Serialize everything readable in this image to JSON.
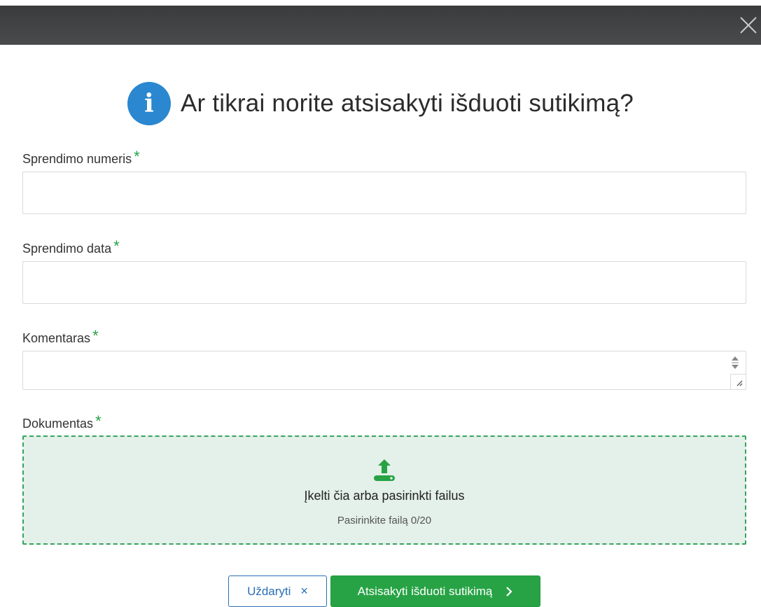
{
  "dialog": {
    "title": "Ar tikrai norite atsisakyti išduoti sutikimą?",
    "info_icon": "info-icon",
    "close_icon": "close-icon"
  },
  "form": {
    "fields": [
      {
        "label": "Sprendimo numeris",
        "required_mark": "*",
        "value": ""
      },
      {
        "label": "Sprendimo data",
        "required_mark": "*",
        "value": ""
      },
      {
        "label": "Komentaras",
        "required_mark": "*",
        "value": ""
      },
      {
        "label": "Dokumentas",
        "required_mark": "*"
      }
    ],
    "dropzone": {
      "icon": "upload-icon",
      "main_text": "Įkelti čia arba pasirinkti failus",
      "sub_text": "Pasirinkite failą 0/20"
    }
  },
  "buttons": {
    "close_label": "Uždaryti",
    "close_icon": "×",
    "confirm_label": "Atsisakyti išduoti sutikimą",
    "confirm_icon": "chevron-right-icon"
  },
  "colors": {
    "accent_green": "#27a345",
    "info_blue": "#2a87d0",
    "link_blue": "#2a6fb5",
    "header_dark": "#3f4042"
  }
}
